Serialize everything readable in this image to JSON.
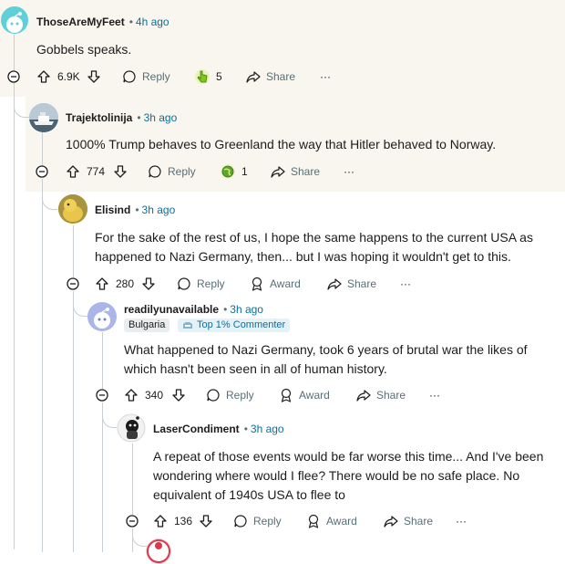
{
  "comments": [
    {
      "author": "ThoseAreMyFeet",
      "time": "4h ago",
      "lines": [
        "Gobbels speaks."
      ],
      "votes": "6.9K",
      "reply": "Reply",
      "award_count": "5",
      "share": "Share",
      "more": "···",
      "avatar": "snoo-avatar-cyan"
    },
    {
      "author": "Trajektolinija",
      "time": "3h ago",
      "lines": [
        "1000% Trump behaves to Greenland the way that Hitler behaved to Norway."
      ],
      "votes": "774",
      "reply": "Reply",
      "award_count": "1",
      "share": "Share",
      "more": "···",
      "avatar": "ship-photo-avatar"
    },
    {
      "author": "Elisind",
      "time": "3h ago",
      "lines": [
        "For the sake of the rest of us, I hope the same happens to the current USA as",
        "happened to Nazi Germany, then... but I was hoping it wouldn't get to this."
      ],
      "votes": "280",
      "reply": "Reply",
      "award": "Award",
      "share": "Share",
      "more": "···",
      "avatar": "duckling-photo-avatar"
    },
    {
      "author": "readilyunavailable",
      "time": "3h ago",
      "flair": "Bulgaria",
      "badge": "Top 1% Commenter",
      "lines": [
        "What happened to Nazi Germany, took 6 years of brutal war the likes of",
        "which hasn't been seen in all of human history."
      ],
      "votes": "340",
      "reply": "Reply",
      "award": "Award",
      "share": "Share",
      "more": "···",
      "avatar": "snoo-avatar-blue"
    },
    {
      "author": "LaserCondiment",
      "time": "3h ago",
      "lines": [
        "A repeat of those events would be far worse this time... And I've been",
        "wondering where would I flee? There would be no safe place. No",
        "equivalent of 1940s USA to flee to"
      ],
      "votes": "136",
      "reply": "Reply",
      "award": "Award",
      "share": "Share",
      "more": "···",
      "avatar": "snoo-avatar-bw"
    }
  ],
  "colors": {
    "highlight": "#f8f6ee",
    "time": "#0e6e99",
    "muted": "#576f76",
    "thread_line": "#c9ced3"
  }
}
